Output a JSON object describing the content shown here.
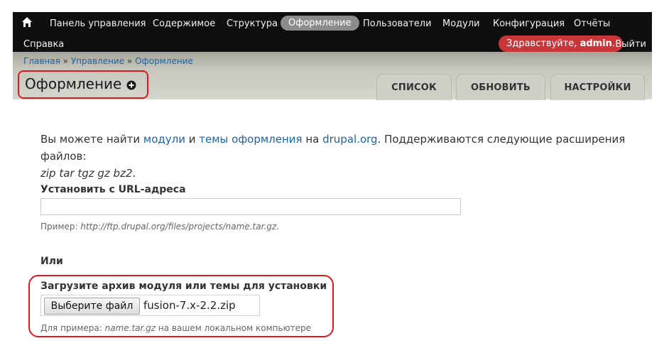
{
  "toolbar": {
    "items": [
      "Панель управления",
      "Содержимое",
      "Структура",
      "Оформление",
      "Пользователи",
      "Модули",
      "Конфигурация",
      "Отчёты"
    ],
    "help": "Справка",
    "hello_prefix": "Здравствуйте, ",
    "user": "admin",
    "hello_suffix": ".",
    "logout": "Выйти",
    "home_icon": "home-icon"
  },
  "breadcrumb": {
    "items": [
      "Главная",
      "Управление",
      "Оформление"
    ],
    "separator": " » "
  },
  "page": {
    "title": "Оформление",
    "add_icon": "plus-circle-icon"
  },
  "tabs": [
    "СПИСОК",
    "ОБНОВИТЬ",
    "НАСТРОЙКИ"
  ],
  "intro": {
    "t1": "Вы можете найти ",
    "link1": "модули",
    "t2": " и ",
    "link2": "темы оформления",
    "t3": " на ",
    "link3": "drupal.org",
    "t4": ". Поддерживаются следующие расширения файлов:",
    "extensions": "zip tar tgz gz bz2",
    "t5": "."
  },
  "url_install": {
    "label": "Установить с URL-адреса",
    "value": "",
    "hint_prefix": "Пример: ",
    "hint_example": "http://ftp.drupal.org/files/projects/name.tar.gz",
    "hint_suffix": "."
  },
  "or_label": "Или",
  "upload": {
    "label": "Загрузите архив модуля или темы для установки",
    "button": "Выберите файл",
    "filename": "fusion-7.x-2.2.zip",
    "hint_prefix": "Для примера: ",
    "hint_example": "name.tar.gz",
    "hint_suffix": " на вашем локальном компьютере"
  },
  "colors": {
    "toolbar_bg": "#0f0f0f",
    "active_pill": "#8c8c8c",
    "greeting": "#c8363a",
    "link": "#1b64a8",
    "highlight": "#e0191f"
  }
}
